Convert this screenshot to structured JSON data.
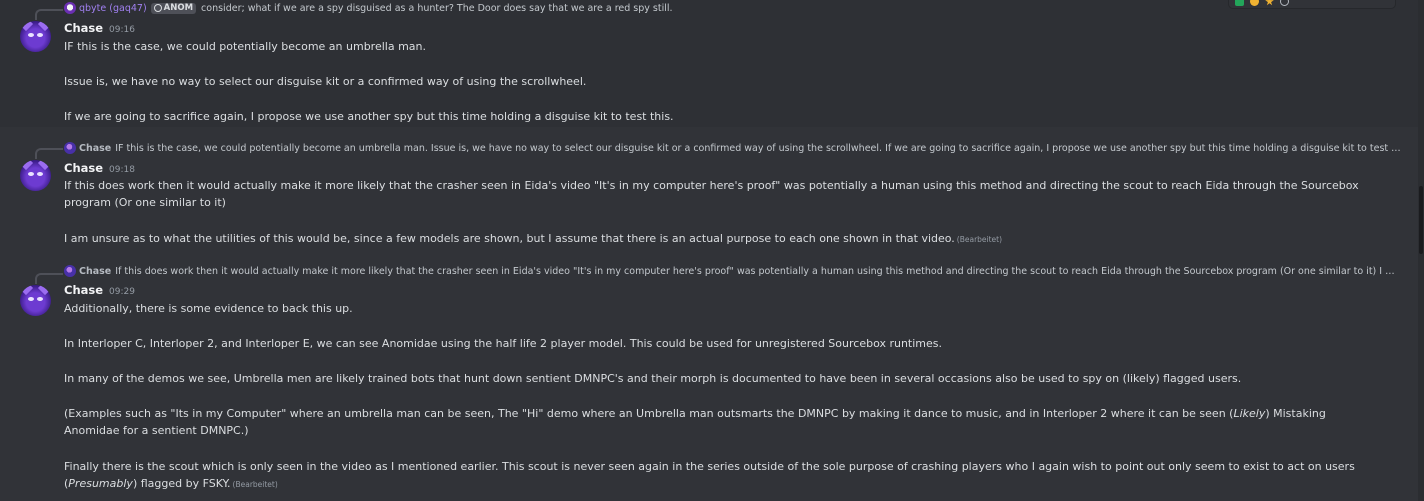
{
  "messages": [
    {
      "reply": {
        "author": "qbyte (gaq47)",
        "tag": "ANOM",
        "text": "consider; what if we are a spy disguised as a hunter? The Door does say that we are a red spy still."
      },
      "author": "Chase",
      "time": "09:16",
      "paragraphs": [
        "IF this is the case, we could potentially become an umbrella man.",
        "Issue is, we have no way to select our disguise kit or a confirmed way of using the scrollwheel.",
        "If we are going to sacrifice again, I propose we use another spy but this time holding a disguise kit to test this."
      ]
    },
    {
      "reply": {
        "author": "Chase",
        "text": "IF this is the case, we could potentially become an umbrella man.   Issue is, we have no way to select our disguise kit or a confirmed way of using the scrollwheel.   If we are going to sacrifice again, I propose we use another spy but this time holding a disguise kit to test this."
      },
      "author": "Chase",
      "time": "09:18",
      "paragraphs": [
        "If this does work then it would actually make it more likely that the crasher seen in Eida's video \"It's in my computer here's proof\" was potentially a human using this method and directing the scout to reach Eida through the Sourcebox program (Or one similar to it)",
        "I am unsure as to what the utilities of this would be, since a few models are shown, but I assume that there is an actual purpose to each one shown in that video."
      ],
      "edited": "(Bearbeitet)"
    },
    {
      "reply": {
        "author": "Chase",
        "text": "If this does work then it would actually make it more likely that the crasher seen in Eida's video \"It's in my computer here's proof\" was potentially a human using this method and directing the scout to reach Eida through the Sourcebox program (Or one similar to it)  I am u..."
      },
      "author": "Chase",
      "time": "09:29",
      "paragraphs": [
        "Additionally, there is some evidence to back this up.",
        "In Interloper C, Interloper 2, and Interloper E, we can see Anomidae using the half life 2 player model. This could be used for unregistered Sourcebox runtimes.",
        "In many of the demos we see, Umbrella men are likely trained bots that hunt down sentient DMNPC's and their morph is documented to have been in several occasions also be used to spy on (likely) flagged users.",
        "(Examples such as \"Its in my Computer\" where an umbrella man can be seen, The \"Hi\" demo where an Umbrella man outsmarts the DMNPC by making it dance to music, and in Interloper 2 where it can be seen (",
        "Likely",
        ") Mistaking Anomidae for a sentient DMNPC.)",
        "Finally there is the scout which is only seen in the video as I mentioned earlier. This scout is never seen again in the series outside of the sole purpose of crashing players who I again wish to point out only seem to exist to act on users (",
        "Presumably",
        ") flagged by FSKY."
      ],
      "edited": "(Bearbeitet)"
    }
  ]
}
